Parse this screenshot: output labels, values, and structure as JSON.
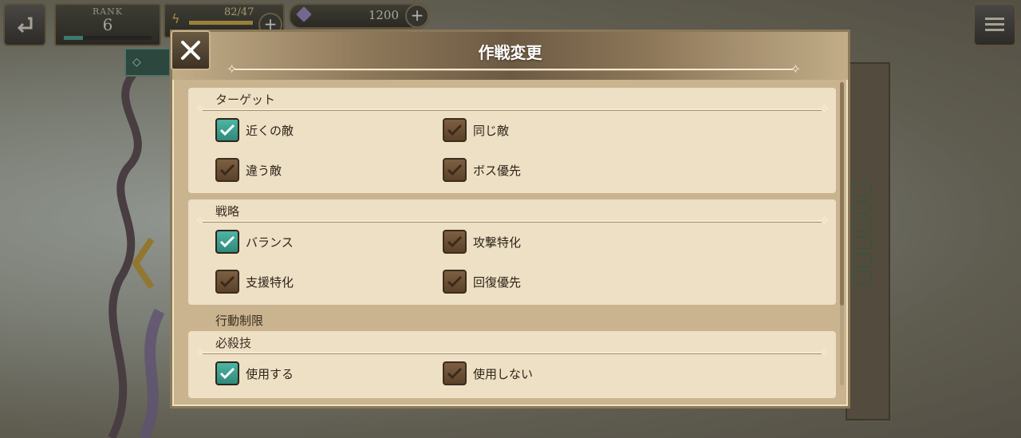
{
  "hud": {
    "rank_label": "RANK",
    "rank_value": "6",
    "rank_progress": 0.22,
    "stamina_text": "82/47",
    "gems_value": "1200",
    "plus_symbol": "+"
  },
  "colors": {
    "checked": "#3a9c8c",
    "unchecked": "#6b4f34",
    "panel": "#eee0c5"
  },
  "modal": {
    "title": "作戦変更",
    "sections": [
      {
        "title": "ターゲット",
        "options": [
          {
            "label": "近くの敵",
            "checked": true
          },
          {
            "label": "同じ敵",
            "checked": false
          },
          {
            "label": "違う敵",
            "checked": false
          },
          {
            "label": "ボス優先",
            "checked": false
          }
        ]
      },
      {
        "title": "戦略",
        "options": [
          {
            "label": "バランス",
            "checked": true
          },
          {
            "label": "攻撃特化",
            "checked": false
          },
          {
            "label": "支援特化",
            "checked": false
          },
          {
            "label": "回復優先",
            "checked": false
          }
        ]
      }
    ],
    "group_title": "行動制限",
    "subsection": {
      "title": "必殺技",
      "options": [
        {
          "label": "使用する",
          "checked": true
        },
        {
          "label": "使用しない",
          "checked": false
        }
      ]
    }
  }
}
